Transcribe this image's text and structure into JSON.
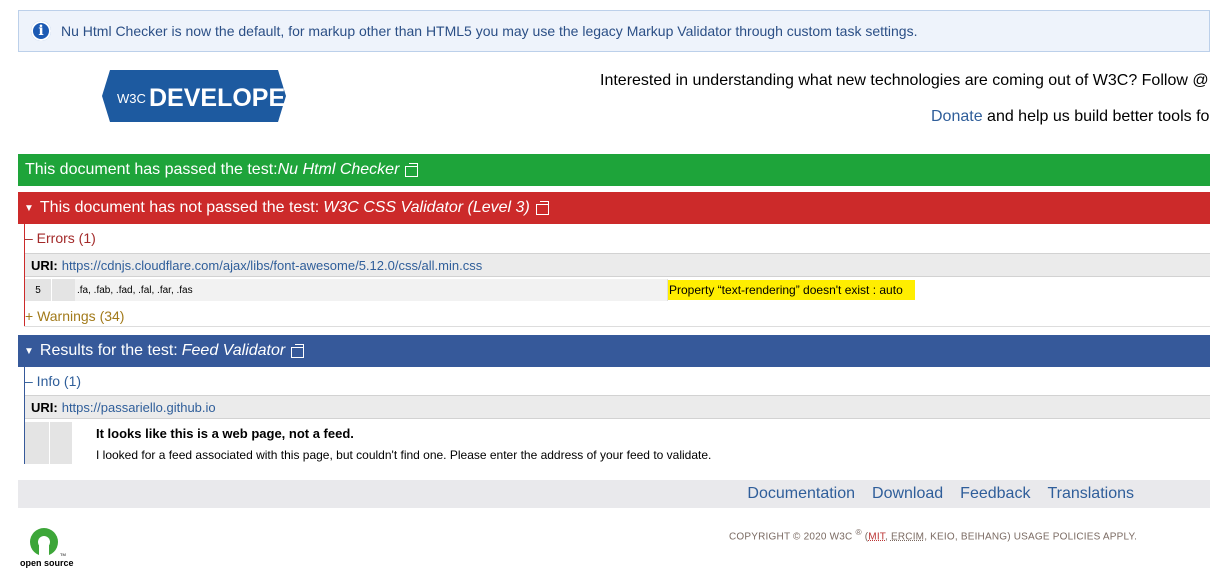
{
  "banner": {
    "icon": "info-icon",
    "text": "Nu Html Checker is now the default, for markup other than HTML5 you may use the legacy Markup Validator through custom task settings."
  },
  "logo": {
    "w3c": "W3C",
    "word": "DEVELOPERS"
  },
  "header": {
    "line1": "Interested in understanding what new technologies are coming out of W3C? Follow @",
    "donate": "Donate",
    "line2_rest": " and help us build better tools fo"
  },
  "results": {
    "nu": {
      "prefix": "This document has passed the test: ",
      "name": "Nu Html Checker"
    },
    "css": {
      "prefix": "This document has not passed the test: ",
      "name": "W3C CSS Validator (Level 3)",
      "errors_toggle": "– Errors (1)",
      "uri_label": "URI:",
      "uri": "https://cdnjs.cloudflare.com/ajax/libs/font-awesome/5.12.0/css/all.min.css",
      "error": {
        "line": "5",
        "selector": ".fa, .fab, .fad, .fal, .far, .fas",
        "message": "Property “text-rendering” doesn't exist : auto"
      },
      "warnings_toggle": "+ Warnings (34)"
    },
    "feed": {
      "prefix": "Results for the test: ",
      "name": "Feed Validator",
      "info_toggle": "– Info (1)",
      "uri_label": "URI:",
      "uri": "https://passariello.github.io",
      "title": "It looks like this is a web page, not a feed.",
      "body": "I looked for a feed associated with this page, but couldn't find one. Please enter the address of your feed to validate."
    }
  },
  "colors": {
    "pass": "#1ea43a",
    "fail": "#cc2a2a",
    "info": "#36599a",
    "highlight": "#ffee00"
  },
  "footer": {
    "links": [
      "Documentation",
      "Download",
      "Feedback",
      "Translations"
    ],
    "copyright_prefix": "COPYRIGHT © 2020 W3C",
    "reg": "®",
    "mit": "MIT",
    "ercim": "ERCIM",
    "rest": ", KEIO, BEIHANG) USAGE POLICIES APPLY.",
    "osi_text": "open source"
  }
}
